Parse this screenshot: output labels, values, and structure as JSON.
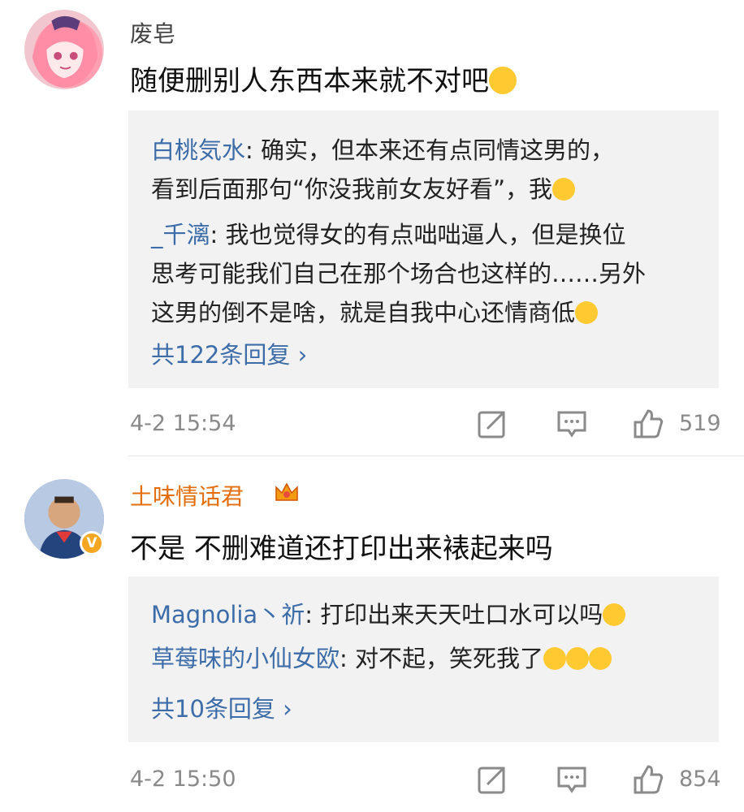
{
  "comments": [
    {
      "username": "废皂",
      "text": "随便删别人东西本来就不对吧",
      "replies": [
        {
          "author": "白桃気水",
          "lines": [
            ": 确实，但本来还有点同情这男的，",
            "看到后面那句“你没我前女友好看”，我"
          ]
        },
        {
          "author": "_千漓",
          "lines": [
            ": 我也觉得女的有点咄咄逼人，但是换位",
            "思考可能我们自己在那个场合也这样的……另外",
            "这男的倒不是啥，就是自我中心还情商低"
          ]
        }
      ],
      "more_replies": "共122条回复 ›",
      "time": "4-2 15:54",
      "likes": "519"
    },
    {
      "username": "土味情话君",
      "verified_badge": "V",
      "text": "不是 不删难道还打印出来裱起来吗",
      "replies": [
        {
          "author": "Magnolia丶祈",
          "lines": [
            ": 打印出来天天吐口水可以吗"
          ]
        },
        {
          "author": "草莓味的小仙女欧",
          "lines": [
            ": 对不起，笑死我了"
          ]
        }
      ],
      "more_replies": "共10条回复 ›",
      "time": "4-2 15:50",
      "likes": "854"
    }
  ],
  "colors": {
    "link": "#3d6da8",
    "vip_name": "#e36c0b",
    "reply_bg": "#f2f2f2",
    "meta": "#8a8a8a"
  },
  "icons": [
    "share-icon",
    "comment-icon",
    "like-icon",
    "crown-icon",
    "emoji-icon"
  ]
}
